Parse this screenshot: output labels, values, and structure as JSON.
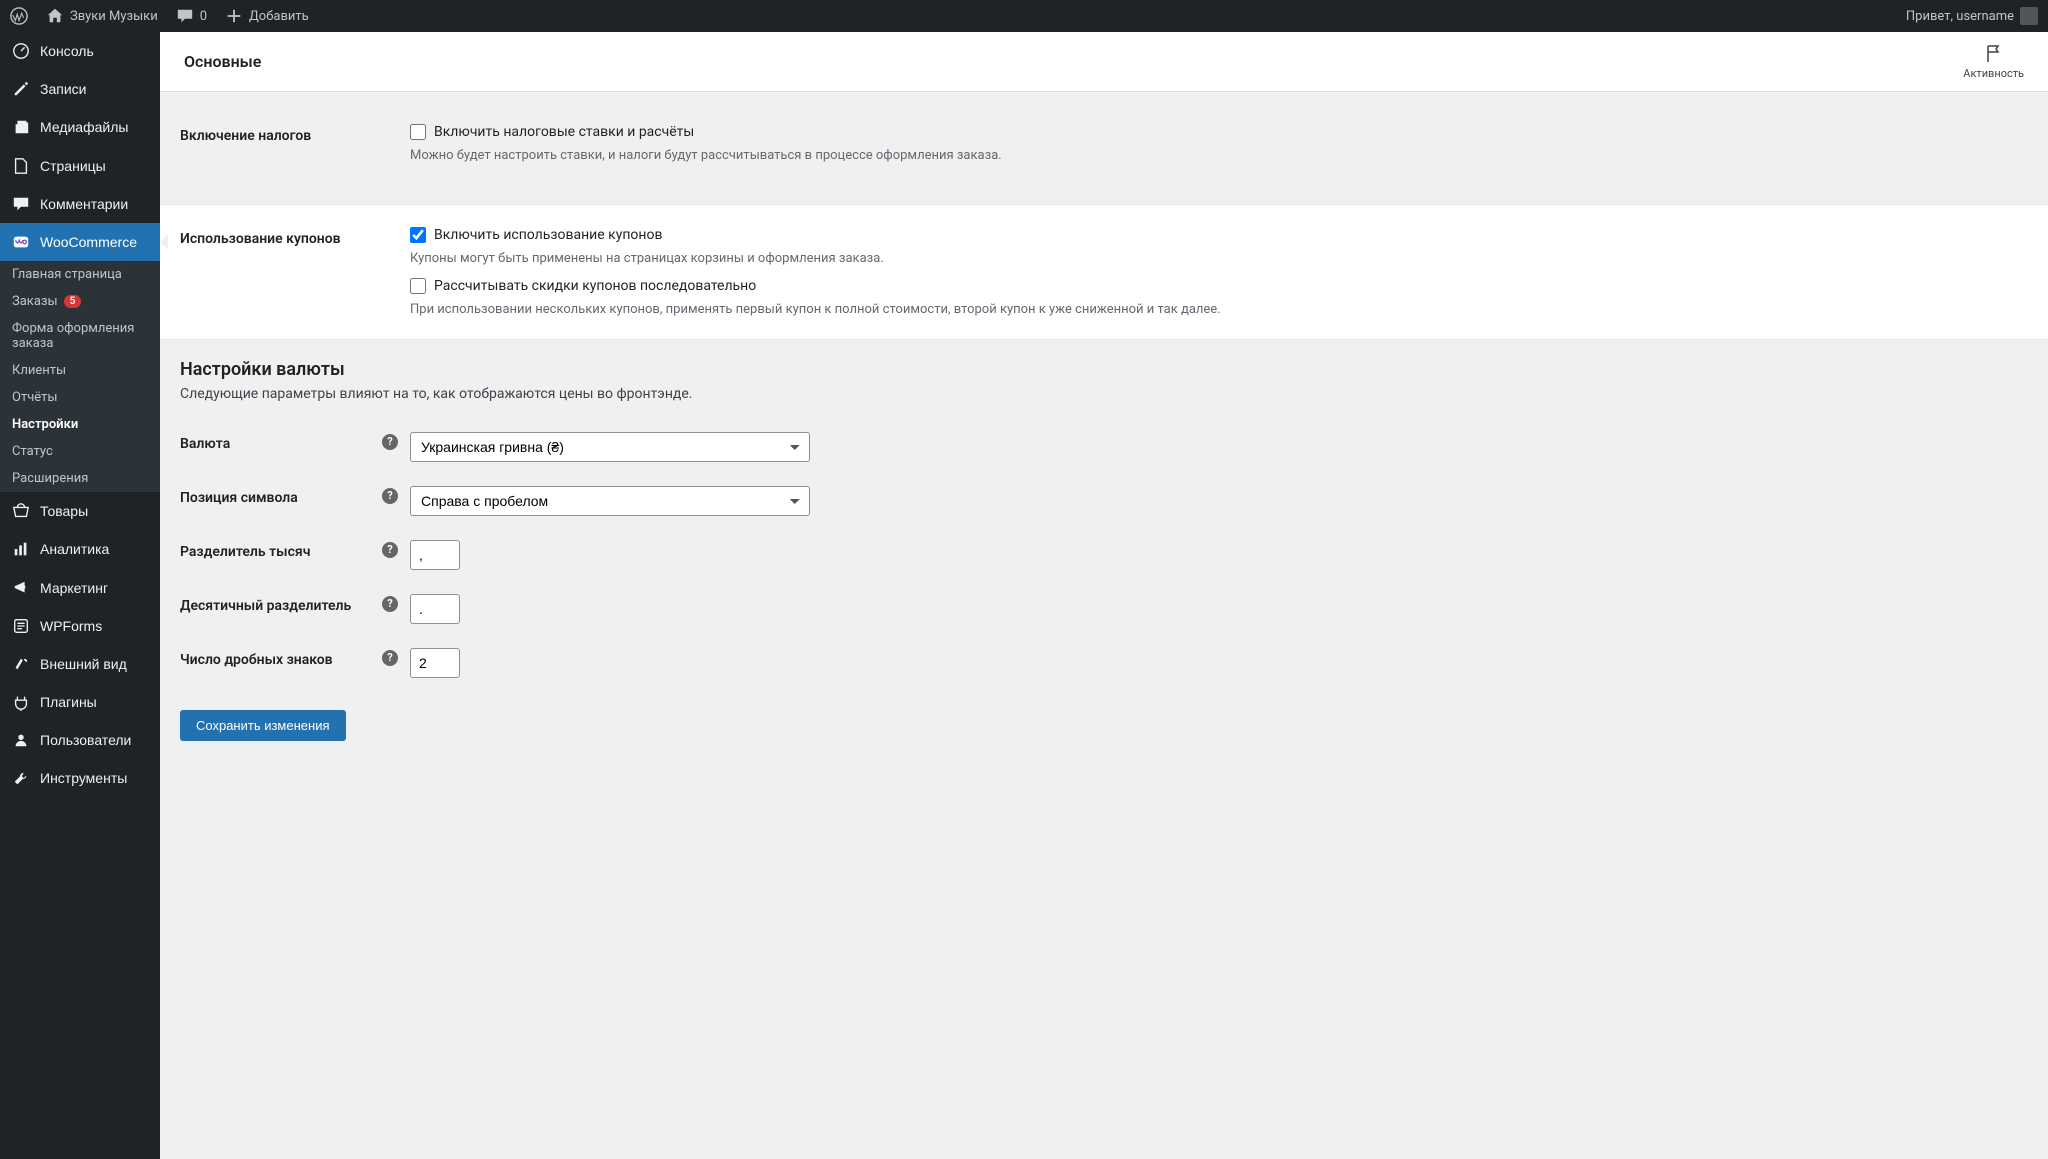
{
  "adminbar": {
    "site_name": "Звуки Музыки",
    "comment_count": "0",
    "add_new": "Добавить",
    "greeting": "Привет, username"
  },
  "sidebar": {
    "items": [
      {
        "label": "Консоль"
      },
      {
        "label": "Записи"
      },
      {
        "label": "Медиафайлы"
      },
      {
        "label": "Страницы"
      },
      {
        "label": "Комментарии"
      },
      {
        "label": "WooCommerce"
      },
      {
        "label": "Товары"
      },
      {
        "label": "Аналитика"
      },
      {
        "label": "Маркетинг"
      },
      {
        "label": "WPForms"
      },
      {
        "label": "Внешний вид"
      },
      {
        "label": "Плагины"
      },
      {
        "label": "Пользователи"
      },
      {
        "label": "Инструменты"
      }
    ],
    "woo_sub": [
      {
        "label": "Главная страница"
      },
      {
        "label": "Заказы",
        "badge": "5"
      },
      {
        "label": "Форма оформления заказа"
      },
      {
        "label": "Клиенты"
      },
      {
        "label": "Отчёты"
      },
      {
        "label": "Настройки"
      },
      {
        "label": "Статус"
      },
      {
        "label": "Расширения"
      }
    ]
  },
  "header": {
    "tab": "Основные",
    "activity": "Активность"
  },
  "section_tax": {
    "label": "Включение налогов",
    "checkbox": "Включить налоговые ставки и расчёты",
    "desc": "Можно будет настроить ставки, и налоги будут рассчитываться в процессе оформления заказа."
  },
  "section_coupons": {
    "label": "Использование купонов",
    "chk1": "Включить использование купонов",
    "desc1": "Купоны могут быть применены на страницах корзины и оформления заказа.",
    "chk2": "Рассчитывать скидки купонов последовательно",
    "desc2": "При использовании нескольких купонов, применять первый купон к полной стоимости, второй купон к уже сниженной и так далее."
  },
  "currency": {
    "title": "Настройки валюты",
    "desc": "Следующие параметры влияют на то, как отображаются цены во фронтэнде.",
    "currency_label": "Валюта",
    "currency_value": "Украинская гривна (₴)",
    "position_label": "Позиция символа",
    "position_value": "Справа с пробелом",
    "thousand_label": "Разделитель тысяч",
    "thousand_value": ",",
    "decimal_label": "Десятичный разделитель",
    "decimal_value": ".",
    "num_decimals_label": "Число дробных знаков",
    "num_decimals_value": "2"
  },
  "save": "Сохранить изменения"
}
